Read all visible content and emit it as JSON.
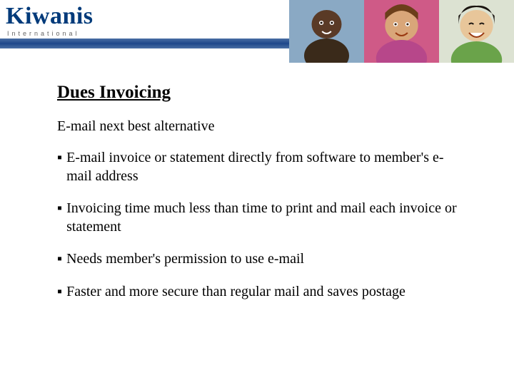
{
  "header": {
    "logo_main": "Kiwanis",
    "logo_sub": "International"
  },
  "content": {
    "title": "Dues Invoicing",
    "subtitle": "E-mail next best alternative",
    "bullets": [
      "E-mail invoice or statement directly from software to member's e-mail address",
      "Invoicing time much less than time to print and mail each invoice or statement",
      "Needs member's permission to use e-mail",
      "Faster and more secure than regular mail and saves postage"
    ]
  },
  "icons": {
    "bullet_marker": "▪"
  }
}
